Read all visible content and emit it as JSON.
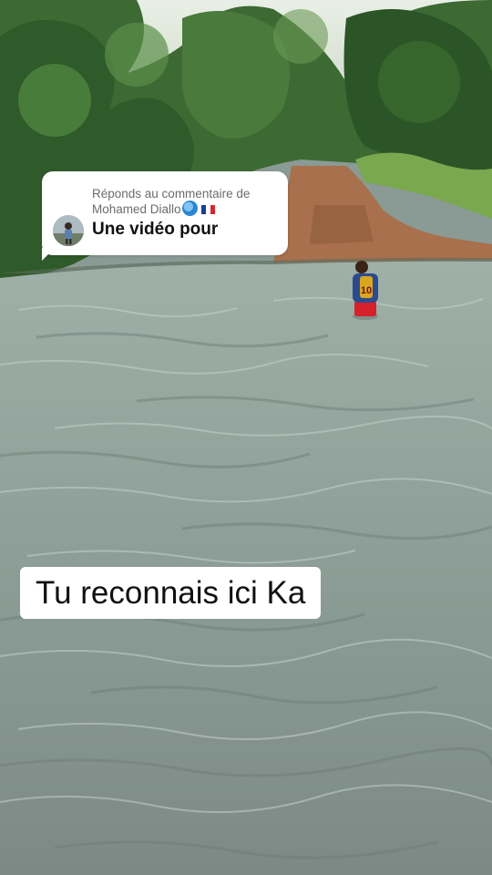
{
  "reply_card": {
    "header_line1": "Réponds au commentaire de",
    "header_line2": "Mohamed Diallo",
    "globe_icon": "globe-icon",
    "flag_icon": "france-flag-icon",
    "comment_text": "Une vidéo pour"
  },
  "caption": {
    "text": "Tu reconnais ici Ka"
  },
  "scene": {
    "description_icon": "river-scene"
  }
}
